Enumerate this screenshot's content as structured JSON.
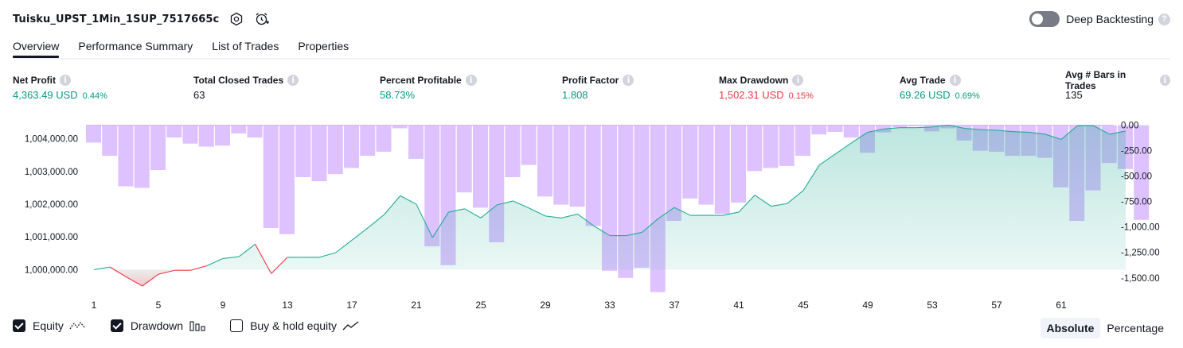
{
  "header": {
    "title": "Tuisku_UPST_1Min_1SUP_7517665c",
    "settings_icon": "hexagon-settings-icon",
    "alert_icon": "alarm-clock-plus-icon",
    "deep_backtesting": {
      "label": "Deep Backtesting",
      "enabled": false,
      "help_icon": "question-icon"
    }
  },
  "tabs": [
    {
      "label": "Overview",
      "active": true
    },
    {
      "label": "Performance Summary",
      "active": false
    },
    {
      "label": "List of Trades",
      "active": false
    },
    {
      "label": "Properties",
      "active": false
    }
  ],
  "stats": [
    {
      "label": "Net Profit",
      "value": "4,363.49 USD",
      "pct": "0.44%",
      "color": "green"
    },
    {
      "label": "Total Closed Trades",
      "value": "63",
      "pct": "",
      "color": "dark"
    },
    {
      "label": "Percent Profitable",
      "value": "58.73%",
      "pct": "",
      "color": "green"
    },
    {
      "label": "Profit Factor",
      "value": "1.808",
      "pct": "",
      "color": "green"
    },
    {
      "label": "Max Drawdown",
      "value": "1,502.31 USD",
      "pct": "0.15%",
      "color": "red"
    },
    {
      "label": "Avg Trade",
      "value": "69.26 USD",
      "pct": "0.69%",
      "color": "green"
    },
    {
      "label": "Avg # Bars in Trades",
      "value": "135",
      "pct": "",
      "color": "dark"
    }
  ],
  "chart_data": {
    "type": "area",
    "x_ticks": [
      "1",
      "5",
      "9",
      "13",
      "17",
      "21",
      "25",
      "29",
      "33",
      "37",
      "41",
      "45",
      "49",
      "53",
      "57",
      "61"
    ],
    "left_axis": {
      "ticks": [
        "1,000,000.00",
        "1,001,000.00",
        "1,002,000.00",
        "1,003,000.00",
        "1,004,000.00"
      ],
      "ylim": [
        999500,
        1004600
      ]
    },
    "right_axis": {
      "ticks": [
        "0.00",
        "-250.00",
        "-500.00",
        "-750.00",
        "-1,000.00",
        "-1,250.00",
        "-1,500.00"
      ],
      "ylim": [
        -1580,
        60
      ]
    },
    "series": [
      {
        "name": "Equity",
        "values": [
          1000000,
          1000080,
          999780,
          999500,
          999860,
          999980,
          999980,
          1000120,
          1000340,
          1000400,
          1000780,
          999880,
          1000380,
          1000380,
          1000380,
          1000520,
          1000900,
          1001280,
          1001680,
          1002260,
          1002000,
          1000980,
          1001760,
          1001860,
          1001580,
          1001980,
          1002100,
          1001880,
          1001640,
          1001580,
          1001700,
          1001340,
          1001040,
          1001040,
          1001140,
          1001560,
          1001900,
          1001660,
          1001660,
          1001660,
          1001760,
          1002280,
          1001940,
          1002020,
          1002420,
          1003200,
          1003540,
          1003880,
          1004200,
          1004300,
          1004340,
          1004340,
          1004360,
          1004420,
          1004320,
          1004280,
          1004260,
          1004220,
          1004200,
          1004140,
          1003980,
          1004400,
          1004400,
          1004140,
          1004240
        ]
      },
      {
        "name": "Drawdown",
        "values": [
          -170,
          -300,
          -600,
          -615,
          -440,
          -120,
          -180,
          -210,
          -200,
          -80,
          -120,
          -1010,
          -1070,
          -510,
          -550,
          -480,
          -420,
          -300,
          -260,
          -30,
          -330,
          -1190,
          -1375,
          -660,
          -810,
          -1150,
          -510,
          -390,
          -700,
          -780,
          -800,
          -990,
          -1430,
          -1500,
          -1400,
          -1640,
          -940,
          -720,
          -780,
          -870,
          -760,
          -450,
          -420,
          -400,
          -300,
          -90,
          -65,
          -120,
          -270,
          -70,
          -20,
          -10,
          -60,
          -30,
          -150,
          -250,
          -260,
          -300,
          -300,
          -320,
          -610,
          -940,
          -640,
          -370,
          -430,
          -930
        ]
      }
    ]
  },
  "legend": [
    {
      "label": "Equity",
      "checked": true,
      "icon": "equity-line-icon"
    },
    {
      "label": "Drawdown",
      "checked": true,
      "icon": "drawdown-bars-icon"
    },
    {
      "label": "Buy & hold equity",
      "checked": false,
      "icon": "buy-hold-line-icon"
    }
  ],
  "modes": [
    {
      "label": "Absolute",
      "selected": true
    },
    {
      "label": "Percentage",
      "selected": false
    }
  ]
}
